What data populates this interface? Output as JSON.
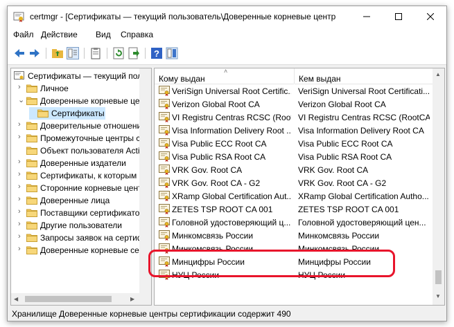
{
  "window": {
    "title": "certmgr - [Сертификаты — текущий пользователь\\Доверенные корневые центр",
    "min_label": "–",
    "max_label": "□",
    "close_label": "✕"
  },
  "menu": [
    "Файл",
    "Действие",
    "Вид",
    "Справка"
  ],
  "toolbar": [
    "back-arrow-icon",
    "forward-arrow-icon",
    "up-folder-icon",
    "show-hide-tree-icon",
    "clipboard-icon",
    "refresh-icon",
    "export-list-icon",
    "help-icon",
    "properties-panel-icon"
  ],
  "tree": {
    "root": "Сертификаты — текущий пользователь",
    "items": [
      {
        "label": "Личное",
        "level": 1,
        "expander": "›"
      },
      {
        "label": "Доверенные корневые центры сертификации",
        "level": 1,
        "expander": "⌄"
      },
      {
        "label": "Сертификаты",
        "level": 2,
        "expander": "",
        "selected": true
      },
      {
        "label": "Доверительные отношения в предприятии",
        "level": 1,
        "expander": "›"
      },
      {
        "label": "Промежуточные центры сертификации",
        "level": 1,
        "expander": "›"
      },
      {
        "label": "Объект пользователя Active Directory",
        "level": 1,
        "expander": ""
      },
      {
        "label": "Доверенные издатели",
        "level": 1,
        "expander": "›"
      },
      {
        "label": "Сертификаты, к которым нет доверия",
        "level": 1,
        "expander": "›"
      },
      {
        "label": "Сторонние корневые центры сертификации",
        "level": 1,
        "expander": "›"
      },
      {
        "label": "Доверенные лица",
        "level": 1,
        "expander": "›"
      },
      {
        "label": "Поставщики сертификатов",
        "level": 1,
        "expander": "›"
      },
      {
        "label": "Другие пользователи",
        "level": 1,
        "expander": "›"
      },
      {
        "label": "Запросы заявок на сертификат",
        "level": 1,
        "expander": "›"
      },
      {
        "label": "Доверенные корневые сертификаты смарт-карты",
        "level": 1,
        "expander": "›"
      }
    ]
  },
  "list": {
    "columns": [
      "Кому выдан",
      "Кем выдан"
    ],
    "rows": [
      [
        "VeriSign Universal Root Certific...",
        "VeriSign Universal Root Certificati..."
      ],
      [
        "Verizon Global Root CA",
        "Verizon Global Root CA"
      ],
      [
        "VI Registru Centras RCSC (Root...",
        "VI Registru Centras RCSC (RootCA)"
      ],
      [
        "Visa Information Delivery Root ...",
        "Visa Information Delivery Root CA"
      ],
      [
        "Visa Public ECC Root CA",
        "Visa Public ECC Root CA"
      ],
      [
        "Visa Public RSA Root CA",
        "Visa Public RSA Root CA"
      ],
      [
        "VRK Gov. Root CA",
        "VRK Gov. Root CA"
      ],
      [
        "VRK Gov. Root CA - G2",
        "VRK Gov. Root CA - G2"
      ],
      [
        "XRamp Global Certification Aut...",
        "XRamp Global Certification Autho..."
      ],
      [
        "ZETES TSP ROOT CA 001",
        "ZETES TSP ROOT CA 001"
      ],
      [
        "Головной удостоверяющий ц...",
        "Головной удостоверяющий цен..."
      ],
      [
        "Минкомсвязь России",
        "Минкомсвязь России"
      ],
      [
        "Минкомсвязь России",
        "Минкомсвязь России"
      ],
      [
        "Минцифры России",
        "Минцифры России"
      ],
      [
        "НУЦ России",
        "НУЦ России"
      ]
    ]
  },
  "status": "Хранилище Доверенные корневые центры сертификации содержит 490",
  "colors": {
    "highlight": "#e8142b",
    "selection": "#cce8ff",
    "folder": "#f2c75c"
  }
}
